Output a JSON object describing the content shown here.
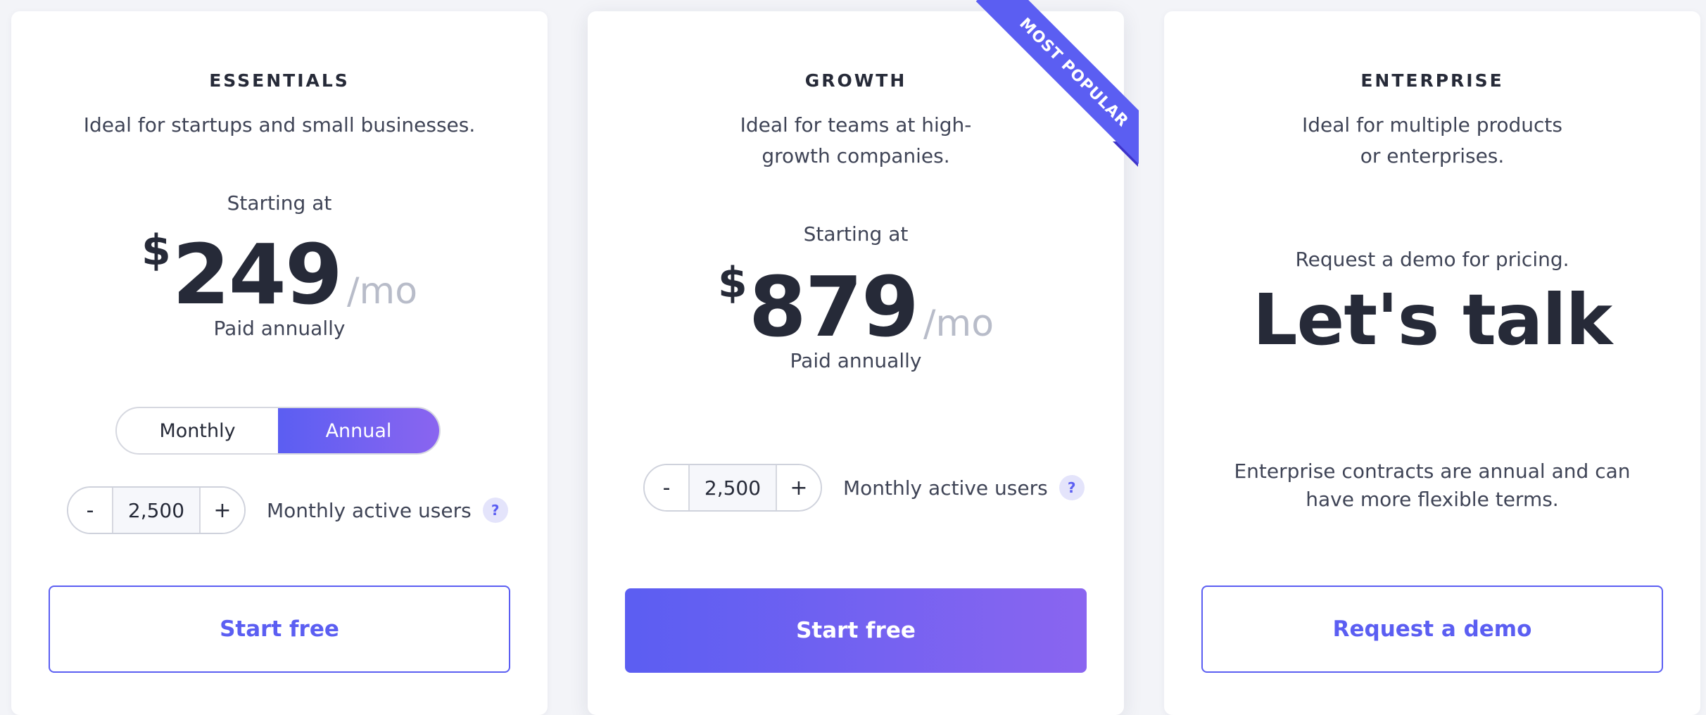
{
  "plans": {
    "essentials": {
      "title": "ESSENTIALS",
      "description": "Ideal for startups and small businesses.",
      "starting_label": "Starting at",
      "currency": "$",
      "price": "249",
      "period": "/mo",
      "billing_note": "Paid annually",
      "billing_toggle": {
        "monthly": "Monthly",
        "annual": "Annual",
        "selected": "Annual"
      },
      "users": {
        "minus": "-",
        "value": "2,500",
        "plus": "+",
        "label": "Monthly active users",
        "help": "?"
      },
      "cta": "Start free"
    },
    "growth": {
      "title": "GROWTH",
      "description": "Ideal for teams at high-growth companies.",
      "ribbon": "MOST POPULAR",
      "starting_label": "Starting at",
      "currency": "$",
      "price": "879",
      "period": "/mo",
      "billing_note": "Paid annually",
      "users": {
        "minus": "-",
        "value": "2,500",
        "plus": "+",
        "label": "Monthly active users",
        "help": "?"
      },
      "cta": "Start free"
    },
    "enterprise": {
      "title": "ENTERPRISE",
      "description": "Ideal for multiple products or enterprises.",
      "pricing_note": "Request a demo for pricing.",
      "headline": "Let's talk",
      "terms": "Enterprise contracts are annual and can have more flexible terms.",
      "cta": "Request a demo"
    }
  },
  "colors": {
    "accent": "#5b5ef2",
    "accent_gradient_end": "#8a65f0",
    "text": "#262a38",
    "muted": "#b8bcc9"
  }
}
